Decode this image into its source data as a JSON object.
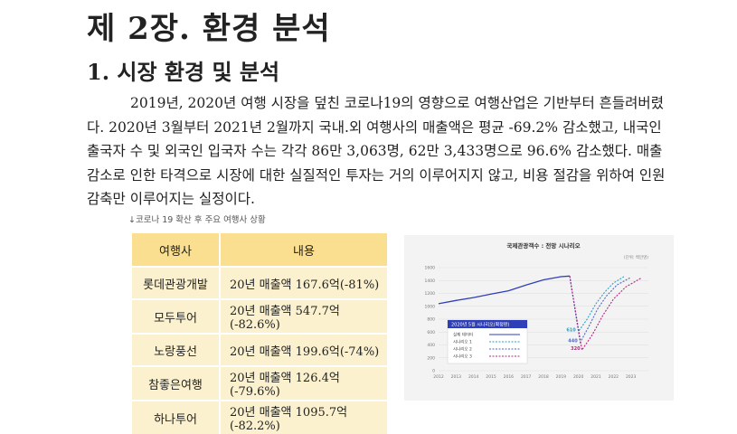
{
  "chapter_title": "제 2장. 환경 분석",
  "section_title": "1. 시장 환경 및 분석",
  "paragraph": "2019년, 2020년 여행 시장을 덮친 코로나19의 영향으로 여행산업은 기반부터 흔들려버렸다. 2020년 3월부터 2021년 2월까지 국내.외 여행사의 매출액은 평균 -69.2% 감소했고, 내국인 출국자 수 및 외국인 입국자 수는 각각 86만 3,063명, 62만 3,433명으로 96.6% 감소했다. 매출 감소로 인한 타격으로 시장에 대한 실질적인 투자는 거의 이루어지지 않고, 비용 절감을 위하여 인원 감축만 이루어지는 실정이다.",
  "caption": "↓코로나 19 확산 후 주요 여행사 상황",
  "table": {
    "headers": [
      "여행사",
      "내용"
    ],
    "rows": [
      [
        "롯데관광개발",
        "20년 매출액 167.6억(-81%)"
      ],
      [
        "모두투어",
        "20년 매출액 547.7억(-82.6%)"
      ],
      [
        "노랑풍선",
        "20년 매출액 199.6억(-74%)"
      ],
      [
        "참좋은여행",
        "20년 매출액 126.4억(-79.6%)"
      ],
      [
        "하나투어",
        "20년 매출액 1095.7억(-82.2%)"
      ]
    ]
  },
  "chart_data": {
    "type": "line",
    "title": "국제관광객수 : 전망 시나리오",
    "unit_note": "(단위: 백만명)",
    "x_ticks": [
      "2012",
      "2013",
      "2014",
      "2015",
      "2016",
      "2017",
      "2018",
      "2019",
      "2020",
      "2021",
      "2022",
      "2023"
    ],
    "y_ticks": [
      0,
      200,
      400,
      600,
      800,
      1000,
      1200,
      1400,
      1600
    ],
    "ylim": [
      0,
      1600
    ],
    "xlim": [
      2012,
      2024
    ],
    "legend_title": "2020년 5월 시나리오(확정판)",
    "colors": {
      "actual": "#2f3fb8",
      "s1": "#2aa0c8",
      "s2": "#4f66c8",
      "s3": "#b0287e",
      "legend_bg": "#2f3fb8"
    },
    "series": [
      {
        "name": "실제 데이터",
        "dash": false,
        "color_key": "actual",
        "points": [
          [
            2012,
            1040
          ],
          [
            2013,
            1090
          ],
          [
            2014,
            1135
          ],
          [
            2015,
            1190
          ],
          [
            2016,
            1240
          ],
          [
            2017,
            1330
          ],
          [
            2018,
            1410
          ],
          [
            2019,
            1460
          ],
          [
            2019.5,
            1470
          ]
        ]
      },
      {
        "name": "시나리오 1",
        "dash": true,
        "color_key": "s1",
        "points": [
          [
            2019.5,
            1470
          ],
          [
            2020,
            610
          ],
          [
            2020.5,
            800
          ],
          [
            2021,
            1040
          ],
          [
            2021.5,
            1220
          ],
          [
            2022,
            1360
          ],
          [
            2022.6,
            1460
          ]
        ]
      },
      {
        "name": "시나리오 2",
        "dash": true,
        "color_key": "s2",
        "points": [
          [
            2019.5,
            1470
          ],
          [
            2020.1,
            440
          ],
          [
            2020.6,
            690
          ],
          [
            2021.1,
            960
          ],
          [
            2021.6,
            1160
          ],
          [
            2022.2,
            1330
          ],
          [
            2023,
            1450
          ]
        ]
      },
      {
        "name": "시나리오 3",
        "dash": true,
        "color_key": "s3",
        "points": [
          [
            2019.5,
            1470
          ],
          [
            2020.2,
            320
          ],
          [
            2020.8,
            560
          ],
          [
            2021.4,
            860
          ],
          [
            2022,
            1110
          ],
          [
            2022.7,
            1300
          ],
          [
            2023.6,
            1440
          ]
        ]
      }
    ],
    "annotations": [
      {
        "text": "610",
        "x": 2019.85,
        "y": 610,
        "color_key": "s1"
      },
      {
        "text": "440",
        "x": 2019.95,
        "y": 440,
        "color_key": "s2"
      },
      {
        "text": "320",
        "x": 2020.1,
        "y": 320,
        "color_key": "s3"
      }
    ]
  }
}
